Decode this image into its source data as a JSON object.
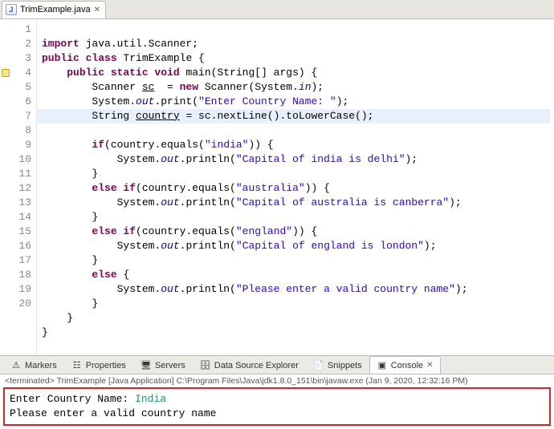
{
  "editor_tab": {
    "filename": "TrimExample.java"
  },
  "gutter": [
    "1",
    "2",
    "3",
    "4",
    "5",
    "6",
    "7",
    "8",
    "9",
    "10",
    "11",
    "12",
    "13",
    "14",
    "15",
    "16",
    "17",
    "18",
    "19",
    "20"
  ],
  "code": {
    "l1": {
      "a": "import",
      "b": " java.util.Scanner;"
    },
    "l2": {
      "a": "public class",
      "b": " TrimExample {"
    },
    "l3": {
      "a": "    ",
      "b": "public static void",
      "c": " main(String[] args) {"
    },
    "l4": {
      "a": "        Scanner ",
      "u": "sc",
      "b": "  = ",
      "c": "new",
      "d": " Scanner(System.",
      "e": "in",
      "f": ");"
    },
    "l5": {
      "a": "        System.",
      "b": "out",
      "c": ".print(",
      "d": "\"Enter Country Name: \"",
      "e": ");"
    },
    "l6": {
      "a": "        String ",
      "u": "country",
      "b": " = sc.nextLine().toLowerCase();"
    },
    "l7": {
      "a": "        ",
      "b": "if",
      "c": "(country.equals(",
      "d": "\"india\"",
      "e": ")) {"
    },
    "l8": {
      "a": "            System.",
      "b": "out",
      "c": ".println(",
      "d": "\"Capital of india is delhi\"",
      "e": ");"
    },
    "l9": {
      "a": "        }"
    },
    "l10": {
      "a": "        ",
      "b": "else if",
      "c": "(country.equals(",
      "d": "\"australia\"",
      "e": ")) {"
    },
    "l11": {
      "a": "            System.",
      "b": "out",
      "c": ".println(",
      "d": "\"Capital of australia is canberra\"",
      "e": ");"
    },
    "l12": {
      "a": "        }"
    },
    "l13": {
      "a": "        ",
      "b": "else if",
      "c": "(country.equals(",
      "d": "\"england\"",
      "e": ")) {"
    },
    "l14": {
      "a": "            System.",
      "b": "out",
      "c": ".println(",
      "d": "\"Capital of england is london\"",
      "e": ");"
    },
    "l15": {
      "a": "        }"
    },
    "l16": {
      "a": "        ",
      "b": "else",
      "c": " {"
    },
    "l17": {
      "a": "            System.",
      "b": "out",
      "c": ".println(",
      "d": "\"Please enter a valid country name\"",
      "e": ");"
    },
    "l18": {
      "a": "        }"
    },
    "l19": {
      "a": "    }"
    },
    "l20": {
      "a": "}"
    }
  },
  "bottom_tabs": {
    "markers": "Markers",
    "properties": "Properties",
    "servers": "Servers",
    "data_source": "Data Source Explorer",
    "snippets": "Snippets",
    "console": "Console"
  },
  "console": {
    "status": "<terminated> TrimExample [Java Application] C:\\Program Files\\Java\\jdk1.8.0_151\\bin\\javaw.exe (Jan 9, 2020, 12:32:16 PM)",
    "line1_prompt": "Enter Country Name: ",
    "line1_input": "   India",
    "line2": "Please enter a valid country name"
  }
}
